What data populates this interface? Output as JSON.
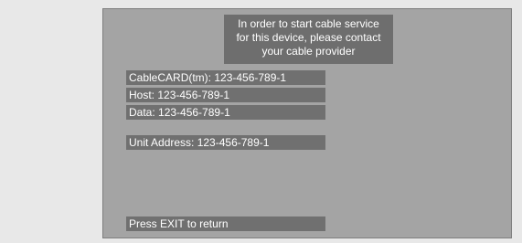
{
  "message": {
    "line1": "In order to start cable service",
    "line2": "for this device, please contact",
    "line3": "your cable provider"
  },
  "info": {
    "cablecard": "CableCARD(tm):  123-456-789-1",
    "host": "Host:  123-456-789-1",
    "data": "Data:  123-456-789-1",
    "unit_address": "Unit Address:  123-456-789-1"
  },
  "footer": {
    "exit": "Press EXIT to return"
  },
  "colors": {
    "page_background": "#e8e8e8",
    "screen_background": "#a4a4a4",
    "bar_background": "#707070",
    "text": "#ffffff"
  }
}
